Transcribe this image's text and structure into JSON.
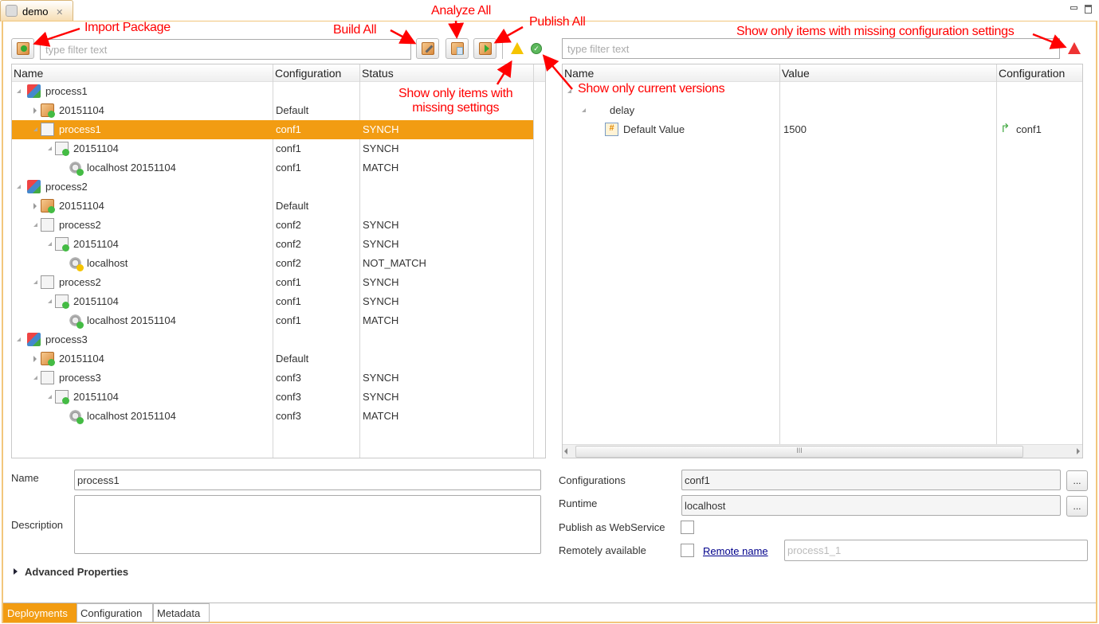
{
  "editor_tab": {
    "label": "demo",
    "close_icon": "close-icon"
  },
  "left": {
    "filter_placeholder": "type filter text",
    "columns": [
      "Name",
      "Configuration",
      "Status"
    ],
    "rows": [
      {
        "name": "process1",
        "level": 0,
        "icon": "process-icon",
        "expander": "open",
        "config": "",
        "status": ""
      },
      {
        "name": "20151104",
        "level": 1,
        "icon": "package-ok-icon",
        "expander": "closed",
        "config": "Default",
        "status": ""
      },
      {
        "name": "process1",
        "level": 1,
        "icon": "deployment-icon",
        "expander": "open",
        "config": "conf1",
        "status": "SYNCH",
        "selected": true
      },
      {
        "name": "20151104",
        "level": 2,
        "icon": "deployment-version-ok-icon",
        "expander": "open",
        "config": "conf1",
        "status": "SYNCH"
      },
      {
        "name": "localhost 20151104",
        "level": 3,
        "icon": "runtime-ok-icon",
        "expander": "none",
        "config": "conf1",
        "status": "MATCH"
      },
      {
        "name": "process2",
        "level": 0,
        "icon": "process-icon",
        "expander": "open",
        "config": "",
        "status": ""
      },
      {
        "name": "20151104",
        "level": 1,
        "icon": "package-ok-icon",
        "expander": "closed",
        "config": "Default",
        "status": ""
      },
      {
        "name": "process2",
        "level": 1,
        "icon": "deployment-icon",
        "expander": "open",
        "config": "conf2",
        "status": "SYNCH"
      },
      {
        "name": "20151104",
        "level": 2,
        "icon": "deployment-version-ok-icon",
        "expander": "open",
        "config": "conf2",
        "status": "SYNCH"
      },
      {
        "name": "localhost",
        "level": 3,
        "icon": "runtime-warning-icon",
        "expander": "none",
        "config": "conf2",
        "status": "NOT_MATCH"
      },
      {
        "name": "process2",
        "level": 1,
        "icon": "deployment-icon",
        "expander": "open",
        "config": "conf1",
        "status": "SYNCH"
      },
      {
        "name": "20151104",
        "level": 2,
        "icon": "deployment-version-ok-icon",
        "expander": "open",
        "config": "conf1",
        "status": "SYNCH"
      },
      {
        "name": "localhost 20151104",
        "level": 3,
        "icon": "runtime-ok-icon",
        "expander": "none",
        "config": "conf1",
        "status": "MATCH"
      },
      {
        "name": "process3",
        "level": 0,
        "icon": "process-icon",
        "expander": "open",
        "config": "",
        "status": ""
      },
      {
        "name": "20151104",
        "level": 1,
        "icon": "package-ok-icon",
        "expander": "closed",
        "config": "Default",
        "status": ""
      },
      {
        "name": "process3",
        "level": 1,
        "icon": "deployment-icon",
        "expander": "open",
        "config": "conf3",
        "status": "SYNCH"
      },
      {
        "name": "20151104",
        "level": 2,
        "icon": "deployment-version-ok-icon",
        "expander": "open",
        "config": "conf3",
        "status": "SYNCH"
      },
      {
        "name": "localhost 20151104",
        "level": 3,
        "icon": "runtime-ok-icon",
        "expander": "none",
        "config": "conf3",
        "status": "MATCH"
      }
    ]
  },
  "right": {
    "filter_placeholder": "type filter text",
    "columns": [
      "Name",
      "Value",
      "Configuration"
    ],
    "rows": [
      {
        "name": "delay",
        "value": "",
        "config": ""
      },
      {
        "name": "Default Value",
        "value": "1500",
        "config": "conf1"
      }
    ]
  },
  "annotations": {
    "import": "Import Package",
    "build": "Build All",
    "analyze": "Analyze All",
    "publish": "Publish All",
    "missing_settings": "Show only items with\nmissing settings",
    "current_versions": "Show only current versions",
    "missing_config": "Show only items with missing configuration settings"
  },
  "form_left": {
    "name_label": "Name",
    "name_value": "process1",
    "description_label": "Description",
    "description_value": "",
    "advanced_label": "Advanced Properties"
  },
  "form_right": {
    "configurations_label": "Configurations",
    "configurations_value": "conf1",
    "runtime_label": "Runtime",
    "runtime_value": "localhost",
    "browse_label": "...",
    "publish_ws_label": "Publish as WebService",
    "publish_ws_checked": false,
    "remote_label": "Remotely available",
    "remote_checked": false,
    "remote_name_link": "Remote name",
    "remote_name_placeholder": "process1_1"
  },
  "bottom_tabs": [
    {
      "label": "Deployments",
      "active": true
    },
    {
      "label": "Configuration"
    },
    {
      "label": "Metadata"
    }
  ],
  "colors": {
    "accent": "#f29c12",
    "annotation": "#ff0000",
    "frame": "#f2c67c"
  }
}
